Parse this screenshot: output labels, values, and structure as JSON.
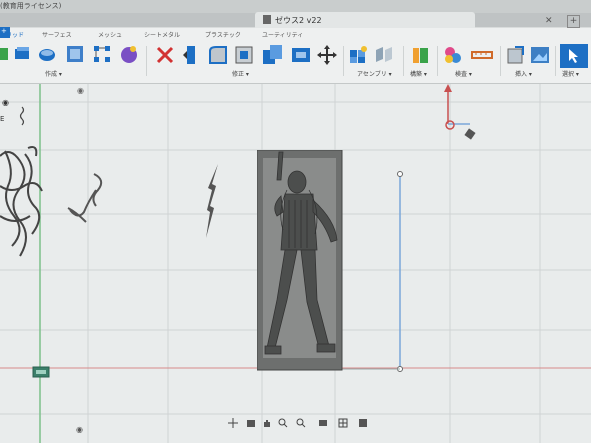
{
  "window": {
    "title_fragment": "(教育用ライセンス)",
    "document_title": "ゼウス2 v22",
    "close_symbol": "✕",
    "new_tab_symbol": "+"
  },
  "workspace": {
    "partial_label": "+"
  },
  "toolbar": {
    "subtabs": [
      "ソリッド",
      "サーフェス",
      "メッシュ",
      "シートメタル",
      "プラスチック",
      "ユーティリティ"
    ],
    "groups": {
      "create": "作成 ▾",
      "modify": "修正 ▾",
      "assemble": "アセンブリ ▾",
      "construct": "構築 ▾",
      "inspect": "検査 ▾",
      "insert": "挿入 ▾",
      "select": "選択 ▾"
    }
  },
  "colors": {
    "accent_blue": "#1d6fc4",
    "delete_red": "#d23232",
    "green": "#3aa34a",
    "grid_axis_green": "#7cc08a",
    "sketch_line_blue": "#7aa7d9",
    "viewcube_red": "#c85050"
  },
  "browser_markers": {
    "bullet": "◉",
    "letter": "E"
  },
  "icons": {
    "bottom_bar": [
      "orbit-icon",
      "camera-icon",
      "pan-hand-icon",
      "zoom-icon",
      "zoom-window-icon",
      "display-mode-icon",
      "grid-icon",
      "viewport-icon"
    ]
  }
}
